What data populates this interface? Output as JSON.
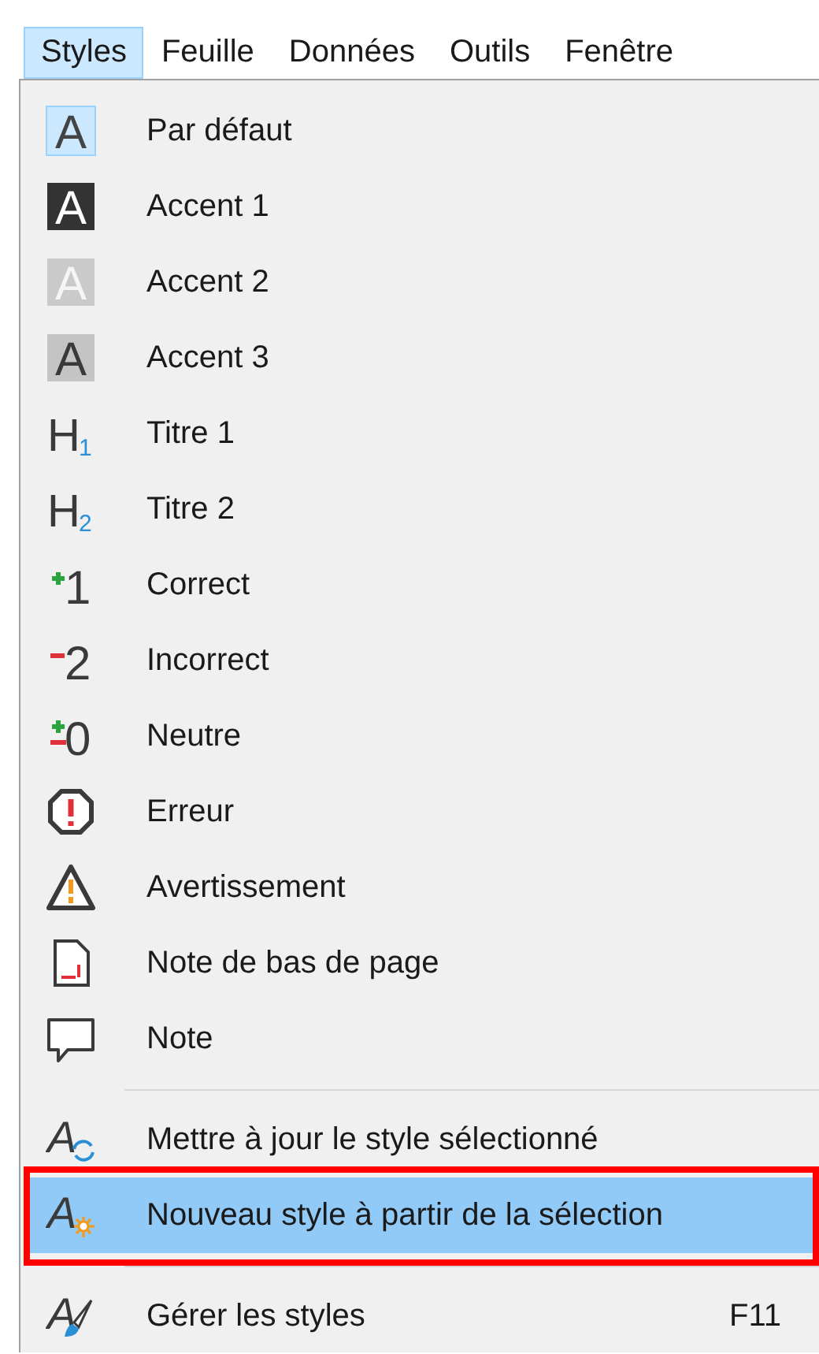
{
  "menubar": [
    {
      "label": "Styles",
      "selected": true
    },
    {
      "label": "Feuille",
      "selected": false
    },
    {
      "label": "Données",
      "selected": false
    },
    {
      "label": "Outils",
      "selected": false
    },
    {
      "label": "Fenêtre",
      "selected": false
    }
  ],
  "items": [
    {
      "kind": "item",
      "label": "Par défaut",
      "icon": {
        "kind": "letter-plain",
        "glyph": "A"
      },
      "checked": true,
      "selected": false,
      "outlined": false
    },
    {
      "kind": "item",
      "label": "Accent 1",
      "icon": {
        "kind": "letter-dark",
        "glyph": "A"
      },
      "checked": false,
      "selected": false,
      "outlined": false
    },
    {
      "kind": "item",
      "label": "Accent 2",
      "icon": {
        "kind": "letter-light",
        "glyph": "A"
      },
      "checked": false,
      "selected": false,
      "outlined": false
    },
    {
      "kind": "item",
      "label": "Accent 3",
      "icon": {
        "kind": "letter-mid",
        "glyph": "A"
      },
      "checked": false,
      "selected": false,
      "outlined": false
    },
    {
      "kind": "item",
      "label": "Titre 1",
      "icon": {
        "kind": "heading",
        "glyph": "H",
        "sub": "1"
      },
      "checked": false,
      "selected": false,
      "outlined": false
    },
    {
      "kind": "item",
      "label": "Titre 2",
      "icon": {
        "kind": "heading",
        "glyph": "H",
        "sub": "2"
      },
      "checked": false,
      "selected": false,
      "outlined": false
    },
    {
      "kind": "item",
      "label": "Correct",
      "icon": {
        "kind": "delta-plus",
        "glyph": "1"
      },
      "checked": false,
      "selected": false,
      "outlined": false
    },
    {
      "kind": "item",
      "label": "Incorrect",
      "icon": {
        "kind": "delta-minus",
        "glyph": "2"
      },
      "checked": false,
      "selected": false,
      "outlined": false
    },
    {
      "kind": "item",
      "label": "Neutre",
      "icon": {
        "kind": "delta-plusminus",
        "glyph": "0"
      },
      "checked": false,
      "selected": false,
      "outlined": false
    },
    {
      "kind": "item",
      "label": "Erreur",
      "icon": {
        "kind": "error"
      },
      "checked": false,
      "selected": false,
      "outlined": false
    },
    {
      "kind": "item",
      "label": "Avertissement",
      "icon": {
        "kind": "warning"
      },
      "checked": false,
      "selected": false,
      "outlined": false
    },
    {
      "kind": "item",
      "label": "Note de bas de page",
      "icon": {
        "kind": "footnote"
      },
      "checked": false,
      "selected": false,
      "outlined": false
    },
    {
      "kind": "item",
      "label": "Note",
      "icon": {
        "kind": "note"
      },
      "checked": false,
      "selected": false,
      "outlined": false
    },
    {
      "kind": "separator"
    },
    {
      "kind": "item",
      "label": "Mettre à jour le style sélectionné",
      "icon": {
        "kind": "update",
        "glyph": "A"
      },
      "checked": false,
      "selected": false,
      "outlined": false
    },
    {
      "kind": "item",
      "label": "Nouveau style à partir de la sélection",
      "icon": {
        "kind": "new",
        "glyph": "A"
      },
      "checked": false,
      "selected": true,
      "outlined": true
    },
    {
      "kind": "separator"
    },
    {
      "kind": "item",
      "label": "Gérer les styles",
      "shortcut": "F11",
      "icon": {
        "kind": "manage",
        "glyph": "A"
      },
      "checked": false,
      "selected": false,
      "outlined": false
    }
  ]
}
